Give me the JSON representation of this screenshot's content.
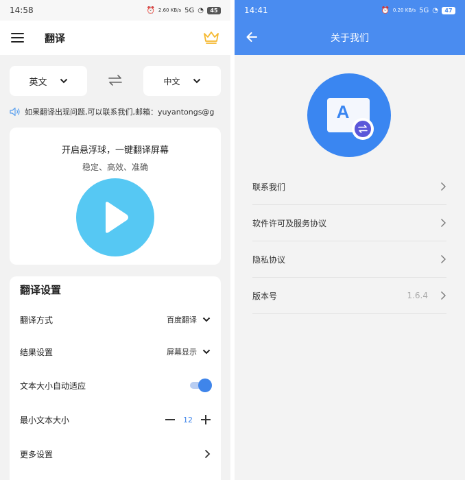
{
  "left": {
    "status_time": "14:58",
    "status_net": "2.60 KB/s",
    "status_signal": "5G",
    "battery": "45",
    "title": "翻译",
    "source_lang": "英文",
    "target_lang": "中文",
    "notice": "如果翻译出现问题,可以联系我们,邮箱：yuyantongs@g",
    "float_title": "开启悬浮球，一键翻译屏幕",
    "float_subtitle": "稳定、高效、准确",
    "settings": {
      "title": "翻译设置",
      "mode_label": "翻译方式",
      "mode_value": "百度翻译",
      "result_label": "结果设置",
      "result_value": "屏幕显示",
      "auto_size_label": "文本大小自动适应",
      "auto_size_on": true,
      "min_size_label": "最小文本大小",
      "min_size_value": "12",
      "more_label": "更多设置"
    }
  },
  "right": {
    "status_time": "14:41",
    "status_net": "0.20 KB/s",
    "status_signal": "5G",
    "battery": "47",
    "title": "关于我们",
    "logo_letter": "A",
    "items": [
      {
        "label": "联系我们"
      },
      {
        "label": "软件许可及服务协议"
      },
      {
        "label": "隐私协议"
      },
      {
        "label": "版本号",
        "value": "1.6.4"
      }
    ]
  },
  "colors": {
    "accent": "#4a8cf0",
    "play_button": "#56c8f3",
    "crown": "#f5b82e"
  }
}
